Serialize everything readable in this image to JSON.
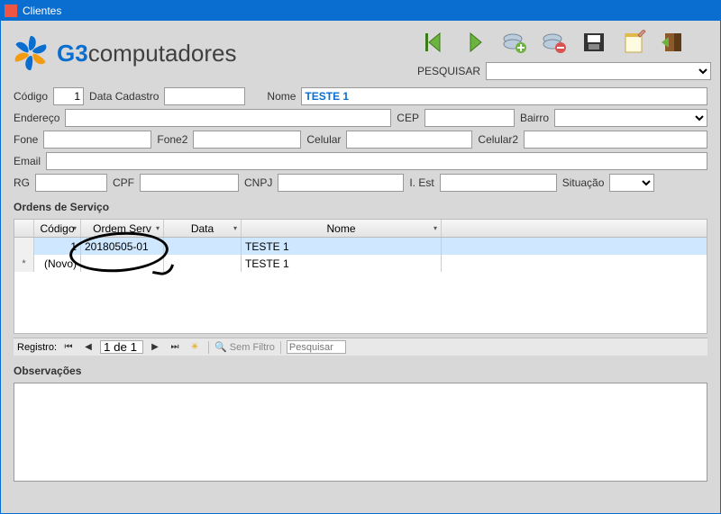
{
  "window": {
    "title": "Clientes"
  },
  "logo": {
    "g3": "G3",
    "rest": "computadores"
  },
  "toolbar": {
    "search_label": "PESQUISAR"
  },
  "form": {
    "codigo_label": "Código",
    "codigo_value": "1",
    "data_cadastro_label": "Data Cadastro",
    "data_cadastro_value": "",
    "nome_label": "Nome",
    "nome_value": "TESTE 1",
    "endereco_label": "Endereço",
    "endereco_value": "",
    "cep_label": "CEP",
    "cep_value": "",
    "bairro_label": "Bairro",
    "bairro_value": "",
    "fone_label": "Fone",
    "fone_value": "",
    "fone2_label": "Fone2",
    "fone2_value": "",
    "celular_label": "Celular",
    "celular_value": "",
    "celular2_label": "Celular2",
    "celular2_value": "",
    "email_label": "Email",
    "email_value": "",
    "rg_label": "RG",
    "rg_value": "",
    "cpf_label": "CPF",
    "cpf_value": "",
    "cnpj_label": "CNPJ",
    "cnpj_value": "",
    "iest_label": "I. Est",
    "iest_value": "",
    "situacao_label": "Situação",
    "situacao_value": ""
  },
  "os_section": {
    "title": "Ordens de Serviço",
    "columns": {
      "codigo": "Código",
      "ordem": "Ordem Serv",
      "data": "Data",
      "nome": "Nome"
    },
    "rows": [
      {
        "marker": "",
        "codigo": "1",
        "ordem": "20180505-01",
        "data": "",
        "nome": "TESTE 1",
        "selected": true
      },
      {
        "marker": "*",
        "codigo": "(Novo)",
        "ordem": "",
        "data": "",
        "nome": "TESTE 1",
        "selected": false
      }
    ]
  },
  "nav": {
    "registro_label": "Registro:",
    "position": "1 de 1",
    "filter_label": "Sem Filtro",
    "search_placeholder": "Pesquisar"
  },
  "obs": {
    "title": "Observações",
    "value": ""
  }
}
